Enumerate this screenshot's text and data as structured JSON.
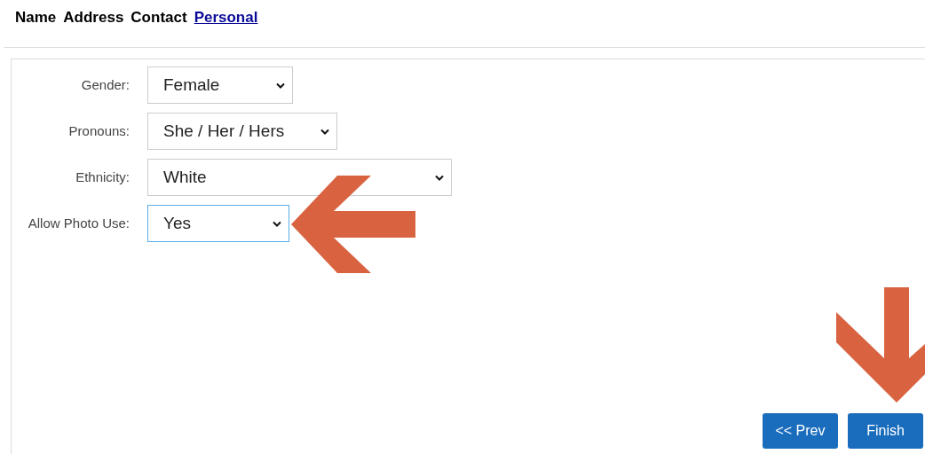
{
  "tabs": [
    {
      "label": "Name",
      "selected": false
    },
    {
      "label": "Address",
      "selected": false
    },
    {
      "label": "Contact",
      "selected": false
    },
    {
      "label": "Personal",
      "selected": true
    }
  ],
  "fields": [
    {
      "label": "Gender:",
      "value": "Female",
      "focused": false
    },
    {
      "label": "Pronouns:",
      "value": "She / Her / Hers",
      "focused": false
    },
    {
      "label": "Ethnicity:",
      "value": "White",
      "focused": false
    },
    {
      "label": "Allow Photo Use:",
      "value": "Yes",
      "focused": true
    }
  ],
  "buttons": [
    "<< Prev",
    "Finish"
  ]
}
